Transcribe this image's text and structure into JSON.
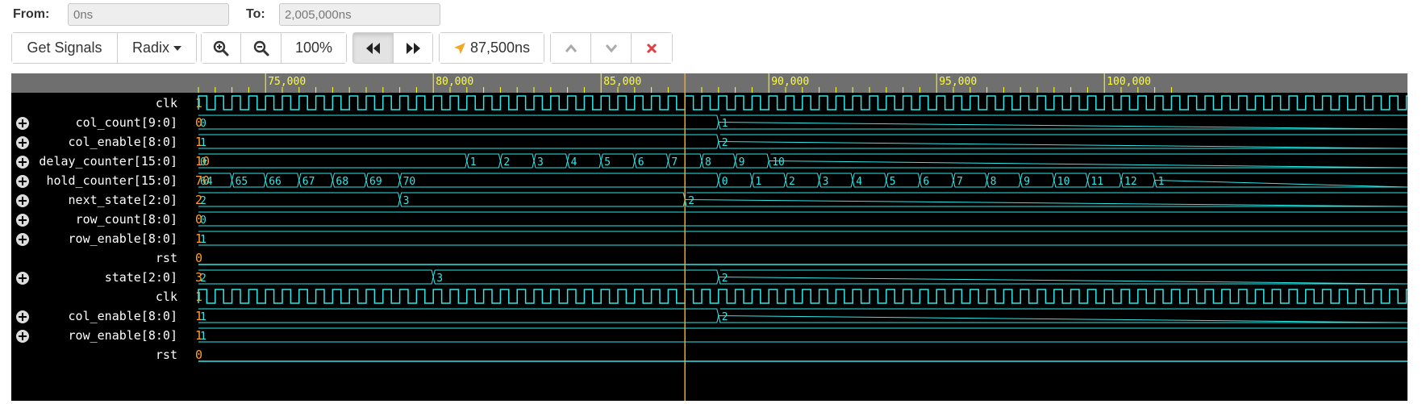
{
  "range": {
    "from_label": "From:",
    "from_value": "0ns",
    "to_label": "To:",
    "to_value": "2,005,000ns"
  },
  "toolbar": {
    "get_signals": "Get Signals",
    "radix": "Radix",
    "zoom_level": "100%",
    "cursor_time": "87,500ns"
  },
  "colors": {
    "cursor": "#f5a623",
    "ruler_text": "#ffff33",
    "wave_high": "#2ee8e8",
    "wave_edge_hi": "#33cc33",
    "bus_text": "#2ee8e8",
    "value_text": "#ff9e2c",
    "remove": "#e04040"
  },
  "ruler": {
    "labels": [
      "75,000",
      "80,000",
      "85,000",
      "90,000",
      "95,000",
      "100,000"
    ]
  },
  "cursor_ns": 87500,
  "signals": [
    {
      "name": "clk",
      "value": "1",
      "expandable": false,
      "kind": "clock"
    },
    {
      "name": "col_count[9:0]",
      "value": "0",
      "expandable": true,
      "kind": "bus",
      "segments": [
        {
          "t": 73000,
          "v": "0"
        },
        {
          "t": 88500,
          "v": "1"
        }
      ]
    },
    {
      "name": "col_enable[8:0]",
      "value": "1",
      "expandable": true,
      "kind": "bus",
      "segments": [
        {
          "t": 73000,
          "v": "1"
        },
        {
          "t": 88500,
          "v": "2"
        }
      ]
    },
    {
      "name": "delay_counter[15:0]",
      "value": "10",
      "expandable": true,
      "kind": "bus",
      "segments": [
        {
          "t": 73000,
          "v": "0"
        },
        {
          "t": 81000,
          "v": "1"
        },
        {
          "t": 82000,
          "v": "2"
        },
        {
          "t": 83000,
          "v": "3"
        },
        {
          "t": 84000,
          "v": "4"
        },
        {
          "t": 85000,
          "v": "5"
        },
        {
          "t": 86000,
          "v": "6"
        },
        {
          "t": 87000,
          "v": "7"
        },
        {
          "t": 88000,
          "v": "8"
        },
        {
          "t": 89000,
          "v": "9"
        },
        {
          "t": 90000,
          "v": "10"
        }
      ]
    },
    {
      "name": "hold_counter[15:0]",
      "value": "70",
      "expandable": true,
      "kind": "bus",
      "segments": [
        {
          "t": 73000,
          "v": "64"
        },
        {
          "t": 74000,
          "v": "65"
        },
        {
          "t": 75000,
          "v": "66"
        },
        {
          "t": 76000,
          "v": "67"
        },
        {
          "t": 77000,
          "v": "68"
        },
        {
          "t": 78000,
          "v": "69"
        },
        {
          "t": 79000,
          "v": "70"
        },
        {
          "t": 88500,
          "v": "0"
        },
        {
          "t": 89500,
          "v": "1"
        },
        {
          "t": 90500,
          "v": "2"
        },
        {
          "t": 91500,
          "v": "3"
        },
        {
          "t": 92500,
          "v": "4"
        },
        {
          "t": 93500,
          "v": "5"
        },
        {
          "t": 94500,
          "v": "6"
        },
        {
          "t": 95500,
          "v": "7"
        },
        {
          "t": 96500,
          "v": "8"
        },
        {
          "t": 97500,
          "v": "9"
        },
        {
          "t": 98500,
          "v": "10"
        },
        {
          "t": 99500,
          "v": "11"
        },
        {
          "t": 100500,
          "v": "12"
        },
        {
          "t": 101500,
          "v": "1"
        }
      ]
    },
    {
      "name": "next_state[2:0]",
      "value": "2",
      "expandable": true,
      "kind": "bus",
      "segments": [
        {
          "t": 73000,
          "v": "2"
        },
        {
          "t": 79000,
          "v": "3"
        },
        {
          "t": 87500,
          "v": "2"
        }
      ]
    },
    {
      "name": "row_count[8:0]",
      "value": "0",
      "expandable": true,
      "kind": "bus",
      "segments": [
        {
          "t": 73000,
          "v": "0"
        }
      ]
    },
    {
      "name": "row_enable[8:0]",
      "value": "1",
      "expandable": true,
      "kind": "bus",
      "segments": [
        {
          "t": 73000,
          "v": "1"
        }
      ]
    },
    {
      "name": "rst",
      "value": "0",
      "expandable": false,
      "kind": "low"
    },
    {
      "name": "state[2:0]",
      "value": "3",
      "expandable": true,
      "kind": "bus",
      "segments": [
        {
          "t": 73000,
          "v": "2"
        },
        {
          "t": 80000,
          "v": "3"
        },
        {
          "t": 88500,
          "v": "2"
        }
      ]
    },
    {
      "name": "clk",
      "value": "1",
      "expandable": false,
      "kind": "clock"
    },
    {
      "name": "col_enable[8:0]",
      "value": "1",
      "expandable": true,
      "kind": "bus",
      "segments": [
        {
          "t": 73000,
          "v": "1"
        },
        {
          "t": 88500,
          "v": "2"
        }
      ]
    },
    {
      "name": "row_enable[8:0]",
      "value": "1",
      "expandable": true,
      "kind": "bus",
      "segments": [
        {
          "t": 73000,
          "v": "1"
        }
      ]
    },
    {
      "name": "rst",
      "value": "0",
      "expandable": false,
      "kind": "low"
    }
  ]
}
